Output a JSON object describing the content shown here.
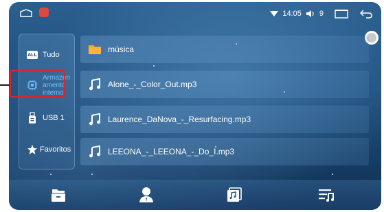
{
  "status": {
    "time": "14:05",
    "volume": "9"
  },
  "sidebar": {
    "items": [
      {
        "label": "Tudo",
        "icon": "all-badge-icon",
        "badge": "ALL"
      },
      {
        "label": "Armazenamento interno",
        "line1": "Armazen",
        "line2": "amento",
        "line3": "interno",
        "icon": "chip-icon"
      },
      {
        "label": "USB 1",
        "icon": "usb-icon"
      },
      {
        "label": "Favoritos",
        "icon": "star-icon"
      }
    ]
  },
  "files": [
    {
      "name": "música",
      "icon": "folder-icon"
    },
    {
      "name": "Alone_-_Color_Out.mp3",
      "icon": "music-note-icon"
    },
    {
      "name": "Laurence_DaNova_-_Resurfacing.mp3",
      "icon": "music-note-icon"
    },
    {
      "name": "LEEONA_-_LEEONA_-_Do_I.mp3",
      "icon": "music-note-icon"
    }
  ],
  "bottom_nav": [
    "file-browser-icon",
    "artist-icon",
    "album-icon",
    "playlist-icon"
  ],
  "colors": {
    "accent": "#6ec3ff",
    "highlight": "#d9262b",
    "folder": "#f4a623"
  }
}
